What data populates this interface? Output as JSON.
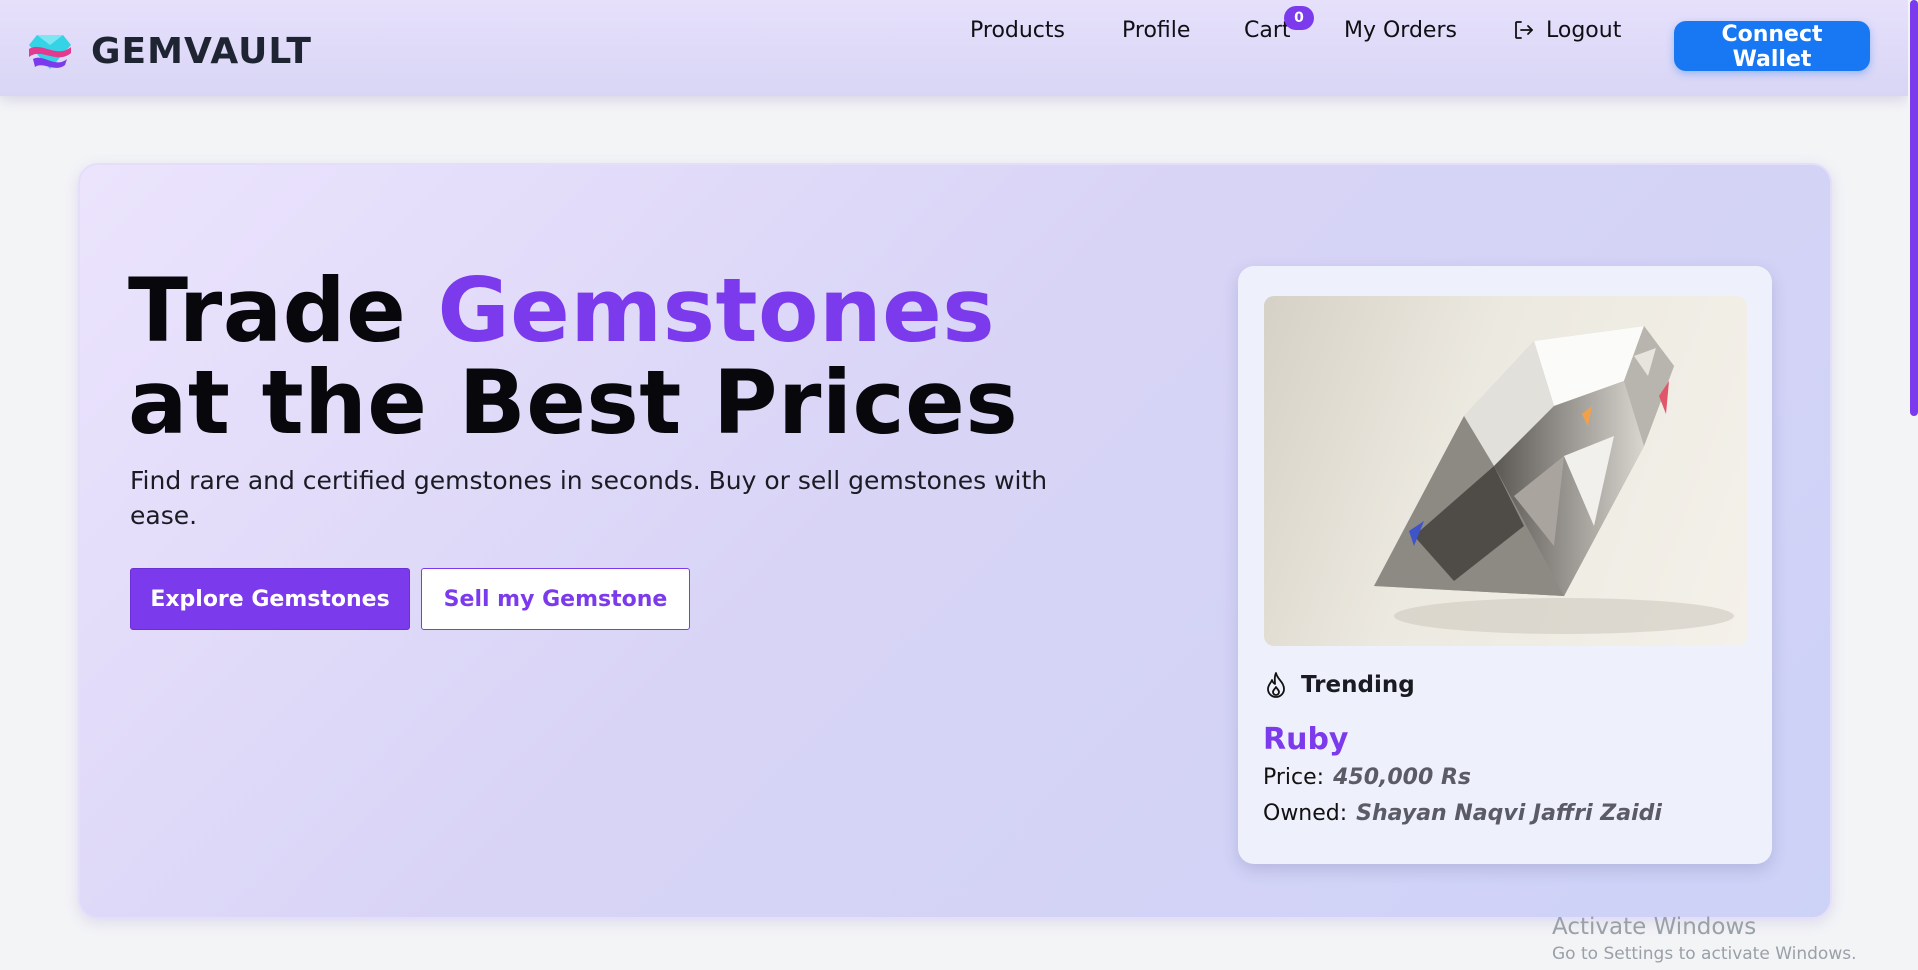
{
  "brand": {
    "name": "GEMVAULT",
    "logo_icon": "gem-logo-icon"
  },
  "nav": {
    "products": "Products",
    "profile": "Profile",
    "cart": "Cart",
    "cart_count": "0",
    "orders": "My Orders",
    "logout": "Logout",
    "logout_icon": "logout-icon",
    "connect_wallet": "Connect Wallet"
  },
  "hero": {
    "title_pre": "Trade ",
    "title_accent": "Gemstones",
    "title_post": " at the Best Prices",
    "subtitle": "Find rare and certified gemstones in seconds. Buy or sell gemstones with ease.",
    "explore_button": "Explore Gemstones",
    "sell_button": "Sell my Gemstone"
  },
  "card": {
    "image_icon": "diamond-image",
    "trending_label": "Trending",
    "trending_icon": "flame-icon",
    "gem_name": "Ruby",
    "price_label": "Price:",
    "price_value": "450,000 Rs",
    "owner_label": "Owned:",
    "owner_value": "Shayan Naqvi Jaffri Zaidi"
  },
  "watermark": {
    "title": "Activate Windows",
    "subtitle": "Go to Settings to activate Windows."
  },
  "colors": {
    "accent": "#7c3aed",
    "connect_button": "#1877f2",
    "navbar": "#e0dbfa",
    "page_bg": "#f3f4f6"
  }
}
